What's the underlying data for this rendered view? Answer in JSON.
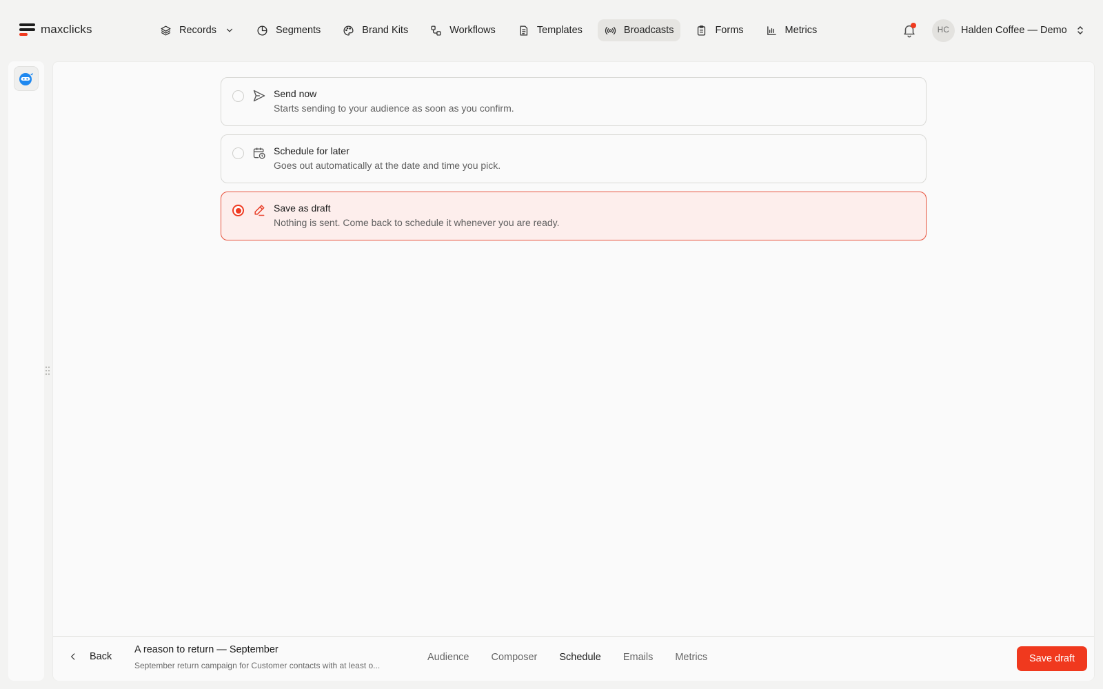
{
  "brand": {
    "name": "maxclicks"
  },
  "nav": {
    "items": [
      {
        "label": "Records",
        "icon": "layers-icon"
      },
      {
        "label": "Segments",
        "icon": "pie-icon"
      },
      {
        "label": "Brand Kits",
        "icon": "palette-icon"
      },
      {
        "label": "Workflows",
        "icon": "workflow-icon"
      },
      {
        "label": "Templates",
        "icon": "document-icon"
      },
      {
        "label": "Broadcasts",
        "icon": "broadcast-icon",
        "active": true
      },
      {
        "label": "Forms",
        "icon": "clipboard-icon"
      },
      {
        "label": "Metrics",
        "icon": "bar-chart-icon"
      }
    ]
  },
  "account": {
    "initials": "HC",
    "name": "Halden Coffee — Demo"
  },
  "colors": {
    "accent": "#f0391e",
    "selected_bg": "#fdeeec",
    "active_nav_bg": "#e6e5e2"
  },
  "options": [
    {
      "title": "Send now",
      "description": "Starts sending to your audience as soon as you confirm.",
      "icon": "send-icon",
      "selected": false
    },
    {
      "title": "Schedule for later",
      "description": "Goes out automatically at the date and time you pick.",
      "icon": "calendar-clock-icon",
      "selected": false
    },
    {
      "title": "Save as draft",
      "description": "Nothing is sent. Come back to schedule it whenever you are ready.",
      "icon": "pencil-icon",
      "selected": true
    }
  ],
  "footer": {
    "back_label": "Back",
    "campaign_title": "A reason to return — September",
    "campaign_subtitle": "September return campaign for Customer contacts with at least o...",
    "tabs": [
      {
        "label": "Audience"
      },
      {
        "label": "Composer"
      },
      {
        "label": "Schedule",
        "active": true
      },
      {
        "label": "Emails"
      },
      {
        "label": "Metrics"
      }
    ],
    "save_label": "Save draft"
  }
}
